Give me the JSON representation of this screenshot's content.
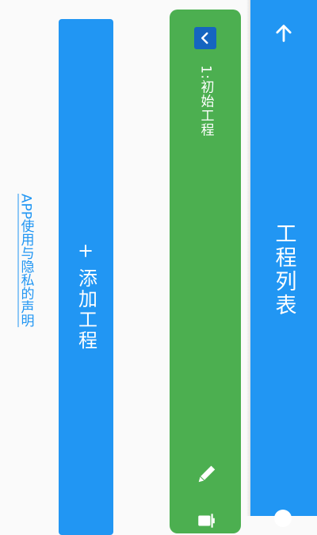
{
  "app_bar": {
    "title": "工程列表",
    "back_icon": "arrow-up-icon",
    "color": "#2196f3"
  },
  "project_card": {
    "name": "1:初始工程",
    "color": "#4caf50",
    "collapse_icon": "chevron-left-icon",
    "edit_icon": "pencil-icon",
    "delete_icon": "trash-icon"
  },
  "add_button": {
    "label": "+ 添加工程",
    "color": "#2196f3"
  },
  "privacy_link": {
    "label": "APP使用与隐私的声明",
    "color": "#2196f3"
  }
}
